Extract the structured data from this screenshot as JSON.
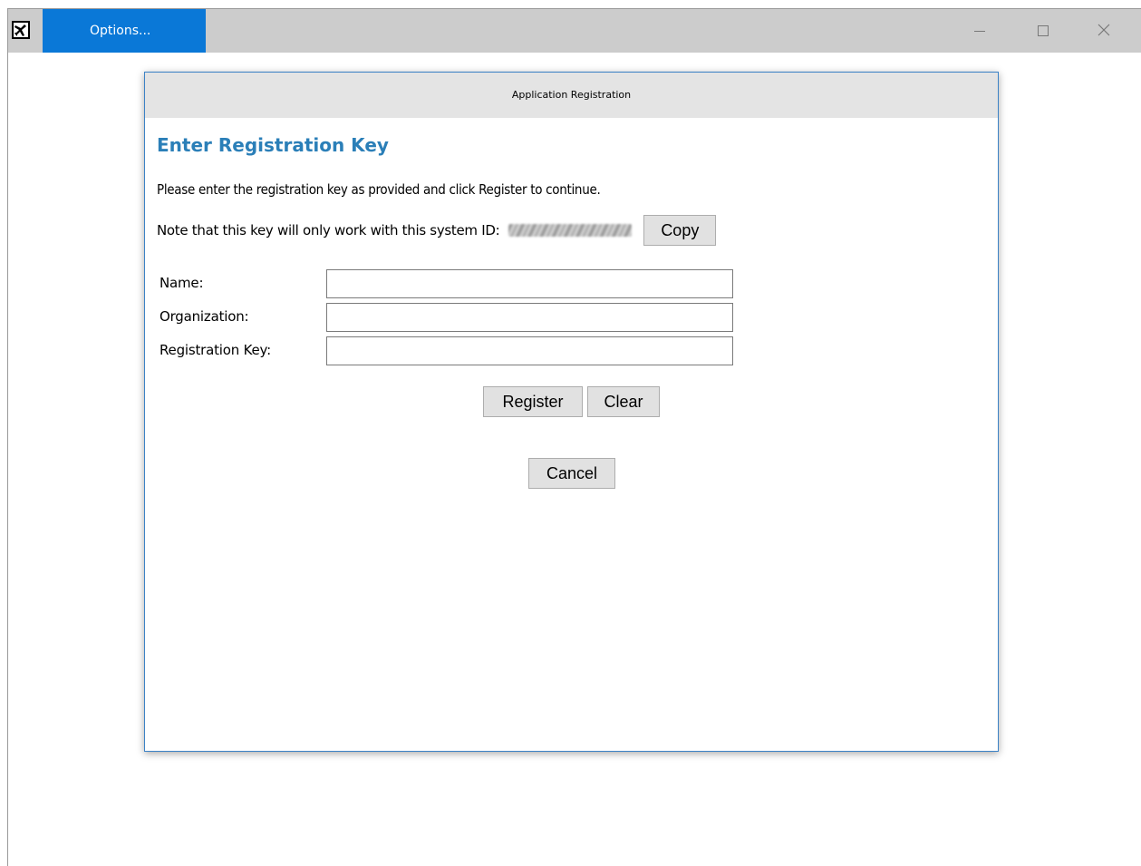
{
  "window": {
    "app_icon": "airplane-icon",
    "tab_label": "Options...",
    "controls": {
      "minimize_icon": "minimize-icon",
      "maximize_icon": "maximize-icon",
      "close_icon": "close-icon"
    }
  },
  "dialog": {
    "title": "Application Registration",
    "heading": "Enter Registration Key",
    "instruction": "Please enter the registration key as provided and click Register to continue.",
    "note_prefix": "Note that this key will only work with this system ID:",
    "copy_label": "Copy",
    "fields": [
      {
        "label": "Name:",
        "value": "",
        "placeholder": ""
      },
      {
        "label": "Organization:",
        "value": "",
        "placeholder": ""
      },
      {
        "label": "Registration Key:",
        "value": "",
        "placeholder": ""
      }
    ],
    "register_label": "Register",
    "clear_label": "Clear",
    "cancel_label": "Cancel"
  },
  "colors": {
    "tab_accent": "#0a78d7",
    "heading": "#2b7fb8",
    "dialog_border": "#3b82c6"
  }
}
